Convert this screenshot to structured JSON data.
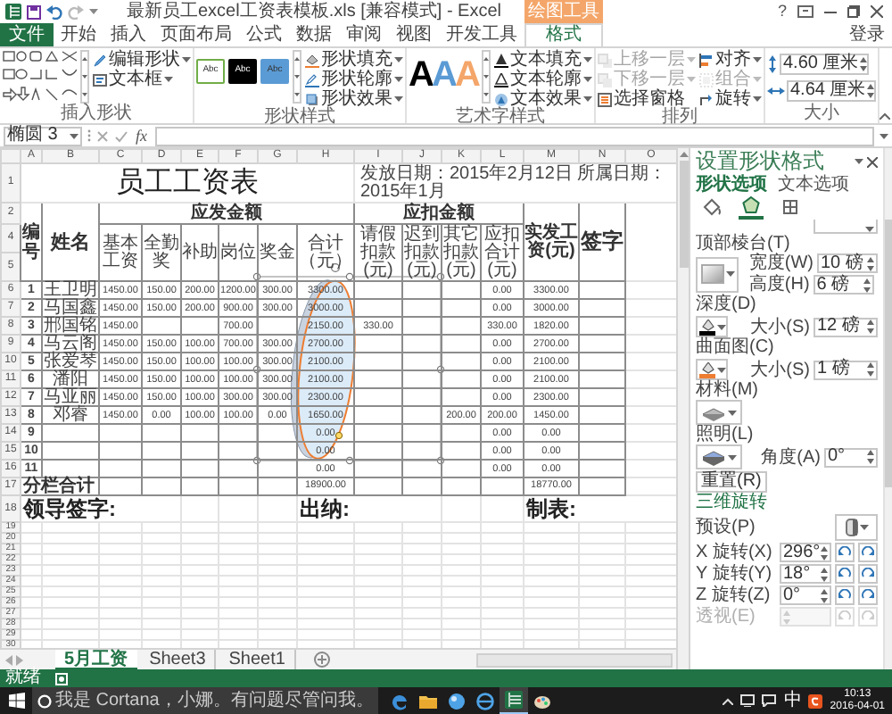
{
  "title_bar": {
    "title": "最新员工excel工资表模板.xls [兼容模式] - Excel",
    "contextual_tab": "绘图工具",
    "help": "?"
  },
  "tabs": [
    {
      "label": "文件",
      "kind": "file",
      "selected": false
    },
    {
      "label": "开始",
      "kind": "tab",
      "selected": false
    },
    {
      "label": "插入",
      "kind": "tab",
      "selected": false
    },
    {
      "label": "页面布局",
      "kind": "tab",
      "selected": false
    },
    {
      "label": "公式",
      "kind": "tab",
      "selected": false
    },
    {
      "label": "数据",
      "kind": "tab",
      "selected": false
    },
    {
      "label": "审阅",
      "kind": "tab",
      "selected": false
    },
    {
      "label": "视图",
      "kind": "tab",
      "selected": false
    },
    {
      "label": "开发工具",
      "kind": "tab",
      "selected": false
    },
    {
      "label": "格式",
      "kind": "tab",
      "selected": true
    }
  ],
  "account": "登录",
  "ribbon": {
    "groups": [
      {
        "kind": "shapes",
        "label": "插入形状",
        "commands": [
          {
            "label": "编辑形状",
            "dropdown": true,
            "disabled": false
          },
          {
            "label": "文本框",
            "dropdown": true,
            "disabled": false
          }
        ]
      },
      {
        "kind": "styles",
        "label": "形状样式",
        "swatches": [
          {
            "text": "Abc",
            "color": "#ffffff"
          },
          {
            "text": "Abc",
            "color": "#000000"
          },
          {
            "text": "Abc",
            "color": "#5b9bd5"
          }
        ],
        "commands": [
          {
            "label": "形状填充",
            "dropdown": true,
            "disabled": false
          },
          {
            "label": "形状轮廓",
            "dropdown": true,
            "disabled": false
          },
          {
            "label": "形状效果",
            "dropdown": true,
            "disabled": false
          }
        ]
      },
      {
        "kind": "wordart",
        "label": "艺术字样式",
        "letters": [
          {
            "text": "A",
            "color": "#000000"
          },
          {
            "text": "A",
            "color": "#5b9bd5"
          },
          {
            "text": "A",
            "color": "#f4a66a"
          }
        ],
        "commands": [
          {
            "label": "文本填充",
            "dropdown": true,
            "disabled": false
          },
          {
            "label": "文本轮廓",
            "dropdown": true,
            "disabled": false
          },
          {
            "label": "文本效果",
            "dropdown": true,
            "disabled": false
          }
        ]
      },
      {
        "kind": "arrange",
        "label": "排列",
        "commands": [
          {
            "label": "上移一层",
            "dropdown": true,
            "disabled": true
          },
          {
            "label": "下移一层",
            "dropdown": true,
            "disabled": true
          },
          {
            "label": "选择窗格",
            "dropdown": false,
            "disabled": false
          },
          {
            "label": "对齐",
            "dropdown": true,
            "disabled": false
          },
          {
            "label": "组合",
            "dropdown": true,
            "disabled": true
          },
          {
            "label": "旋转",
            "dropdown": true,
            "disabled": false
          }
        ]
      },
      {
        "kind": "size",
        "label": "大小",
        "fields": [
          {
            "kind": "height",
            "value": "4.60 厘米"
          },
          {
            "kind": "width",
            "value": "4.64 厘米"
          }
        ]
      }
    ]
  },
  "formula_bar": {
    "name_box": "椭圆 3",
    "function_label": "fx"
  },
  "sheet": {
    "columns": [
      "A",
      "B",
      "C",
      "D",
      "E",
      "F",
      "G",
      "H",
      "I",
      "J",
      "K",
      "L",
      "M",
      "N",
      "O"
    ],
    "title_row": "1",
    "title": "员工工资表",
    "dates": "发放日期：2015年2月12日 所属日期：2015年1月",
    "header_rows": [
      "2",
      "4",
      "5"
    ],
    "headers": {
      "number": "编号",
      "name": "姓名",
      "earnings_group": "应发金额",
      "deductions_group": "应扣金额",
      "earnings": [
        "基本工资",
        "全勤奖",
        "补助",
        "岗位",
        "奖金",
        "合计（元）"
      ],
      "deductions": [
        "请假扣款(元)",
        "迟到扣款(元)",
        "其它扣款(元)",
        "应扣合计(元)"
      ],
      "net": "实发工资(元)",
      "signature": "签字"
    },
    "rows": [
      {
        "row": "6",
        "cells": [
          "1",
          "王卫明",
          "1450.00",
          "150.00",
          "200.00",
          "1200.00",
          "300.00",
          "3300.00",
          null,
          null,
          null,
          "0.00",
          "3300.00"
        ]
      },
      {
        "row": "7",
        "cells": [
          "2",
          "马国鑫",
          "1450.00",
          "150.00",
          "200.00",
          "900.00",
          "300.00",
          "3000.00",
          null,
          null,
          null,
          "0.00",
          "3000.00"
        ]
      },
      {
        "row": "8",
        "cells": [
          "3",
          "邢国铭",
          "1450.00",
          null,
          null,
          "700.00",
          null,
          "2150.00",
          "330.00",
          null,
          null,
          "330.00",
          "1820.00"
        ]
      },
      {
        "row": "9",
        "cells": [
          "4",
          "马云阁",
          "1450.00",
          "150.00",
          "100.00",
          "700.00",
          "300.00",
          "2700.00",
          null,
          null,
          null,
          "0.00",
          "2700.00"
        ]
      },
      {
        "row": "10",
        "cells": [
          "5",
          "张爱琴",
          "1450.00",
          "150.00",
          "100.00",
          "100.00",
          "300.00",
          "2100.00",
          null,
          null,
          null,
          "0.00",
          "2100.00"
        ]
      },
      {
        "row": "11",
        "cells": [
          "6",
          "潘阳",
          "1450.00",
          "150.00",
          "100.00",
          "100.00",
          "300.00",
          "2100.00",
          null,
          null,
          null,
          "0.00",
          "2100.00"
        ]
      },
      {
        "row": "12",
        "cells": [
          "7",
          "马亚丽",
          "1450.00",
          "150.00",
          "100.00",
          "300.00",
          "300.00",
          "2300.00",
          null,
          null,
          null,
          "0.00",
          "2300.00"
        ]
      },
      {
        "row": "13",
        "cells": [
          "8",
          "邓睿",
          "1450.00",
          "0.00",
          "100.00",
          "100.00",
          "0.00",
          "1650.00",
          null,
          null,
          "200.00",
          "200.00",
          "1450.00"
        ]
      },
      {
        "row": "14",
        "cells": [
          "9",
          null,
          null,
          null,
          null,
          null,
          null,
          "0.00",
          null,
          null,
          null,
          "0.00",
          "0.00"
        ]
      },
      {
        "row": "15",
        "cells": [
          "10",
          null,
          null,
          null,
          null,
          null,
          null,
          "0.00",
          null,
          null,
          null,
          "0.00",
          "0.00"
        ]
      },
      {
        "row": "16",
        "cells": [
          "11",
          null,
          null,
          null,
          null,
          null,
          null,
          "0.00",
          null,
          null,
          null,
          "0.00",
          "0.00"
        ]
      }
    ],
    "total": {
      "row": "17",
      "label": "分栏合计",
      "cells": [
        null,
        null,
        null,
        null,
        null,
        "18900.00",
        null,
        null,
        null,
        null,
        "18770.00"
      ]
    },
    "signatures": {
      "row": "18",
      "labels": [
        "领导签字:",
        "出纳:",
        "制表:"
      ]
    },
    "empty_rows": [
      "19",
      "20",
      "21",
      "22",
      "23",
      "24",
      "25",
      "26",
      "27",
      "28",
      "29",
      "30"
    ],
    "shape": {
      "kind": "ellipse",
      "selected": true
    }
  },
  "sheet_tabs": [
    {
      "label": "5月工资",
      "selected": true
    },
    {
      "label": "Sheet3",
      "selected": false
    },
    {
      "label": "Sheet1",
      "selected": false
    }
  ],
  "pane": {
    "title": "设置形状格式",
    "tabs": [
      {
        "label": "形状选项",
        "selected": true
      },
      {
        "label": "文本选项",
        "selected": false
      }
    ],
    "icon_tabs": [
      {
        "kind": "fill",
        "selected": false
      },
      {
        "kind": "effects",
        "selected": true
      },
      {
        "kind": "size",
        "selected": false
      }
    ],
    "top_bevel": {
      "label": "顶部棱台(T)",
      "width_label": "宽度(W)",
      "width": "10 磅",
      "height_label": "高度(H)",
      "height": "6 磅"
    },
    "depth": {
      "label": "深度(D)",
      "size_label": "大小(S)",
      "size": "12 磅",
      "color": "#000000"
    },
    "contour": {
      "label": "曲面图(C)",
      "size_label": "大小(S)",
      "size": "1 磅",
      "color": "#ed7d31"
    },
    "material": {
      "label": "材料(M)"
    },
    "lighting": {
      "label": "照明(L)",
      "angle_label": "角度(A)",
      "angle": "0°"
    },
    "reset": "重置(R)",
    "rotation": {
      "heading": "三维旋转",
      "preset_label": "预设(P)",
      "axes": [
        {
          "label": "X 旋转(X)",
          "value": "296°"
        },
        {
          "label": "Y 旋转(Y)",
          "value": "18°"
        },
        {
          "label": "Z 旋转(Z)",
          "value": "0°"
        }
      ],
      "perspective": {
        "label": "透视(E)",
        "disabled": true
      }
    }
  },
  "status": "就绪",
  "taskbar": {
    "search_placeholder": "我是 Cortana，小娜。有问题尽管问我。",
    "apps": [
      {
        "kind": "edge",
        "selected": false
      },
      {
        "kind": "folder",
        "selected": false
      },
      {
        "kind": "globe",
        "selected": false
      },
      {
        "kind": "browser",
        "selected": false
      },
      {
        "kind": "excel",
        "selected": true
      },
      {
        "kind": "paint",
        "selected": false
      }
    ],
    "ime": "中",
    "time": "10:13",
    "date": "2016-04-01"
  }
}
